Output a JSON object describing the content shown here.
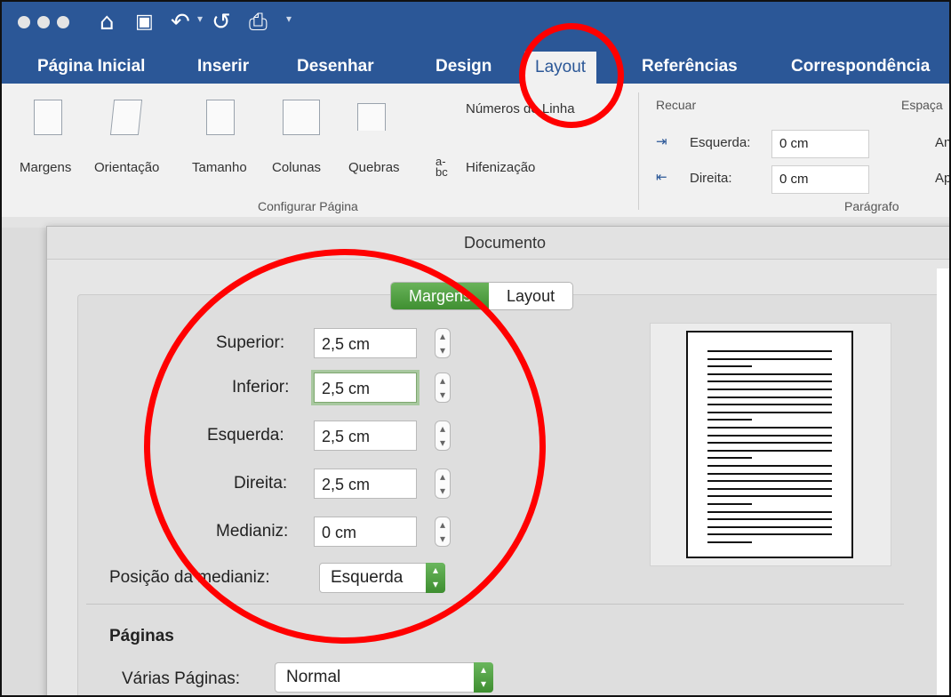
{
  "ribbon_tabs": [
    "Página Inicial",
    "Inserir",
    "Desenhar",
    "Design",
    "Layout",
    "Referências",
    "Correspondência"
  ],
  "ribbon": {
    "line_numbers": "Números de Linha",
    "hyphenation": "Hifenização",
    "hyphen_glyph": "a-\nbc",
    "page_setup_buttons": [
      "Margens",
      "Orientação",
      "Tamanho",
      "Colunas",
      "Quebras"
    ],
    "group_page_setup": "Configurar Página",
    "indent_title": "Recuar",
    "spacing_title": "Espaça",
    "indent_left_label": "Esquerda:",
    "indent_left_value": "0 cm",
    "indent_right_label": "Direita:",
    "indent_right_value": "0 cm",
    "spacing_before": "An",
    "spacing_after": "Ap",
    "group_paragraph": "Parágrafo"
  },
  "dialog": {
    "title": "Documento",
    "segments": [
      "Margens",
      "Layout"
    ],
    "fields": [
      {
        "label": "Superior:",
        "value": "2,5 cm"
      },
      {
        "label": "Inferior:",
        "value": "2,5 cm"
      },
      {
        "label": "Esquerda:",
        "value": "2,5 cm"
      },
      {
        "label": "Direita:",
        "value": "2,5 cm"
      },
      {
        "label": "Medianiz:",
        "value": "0 cm"
      }
    ],
    "gutter_position_label": "Posição da medianiz:",
    "gutter_position_value": "Esquerda",
    "pages_heading": "Páginas",
    "multiple_pages_label": "Várias Páginas:",
    "multiple_pages_value": "Normal"
  },
  "annotation_color": "#ff0000",
  "accent_color": "#2b5797"
}
